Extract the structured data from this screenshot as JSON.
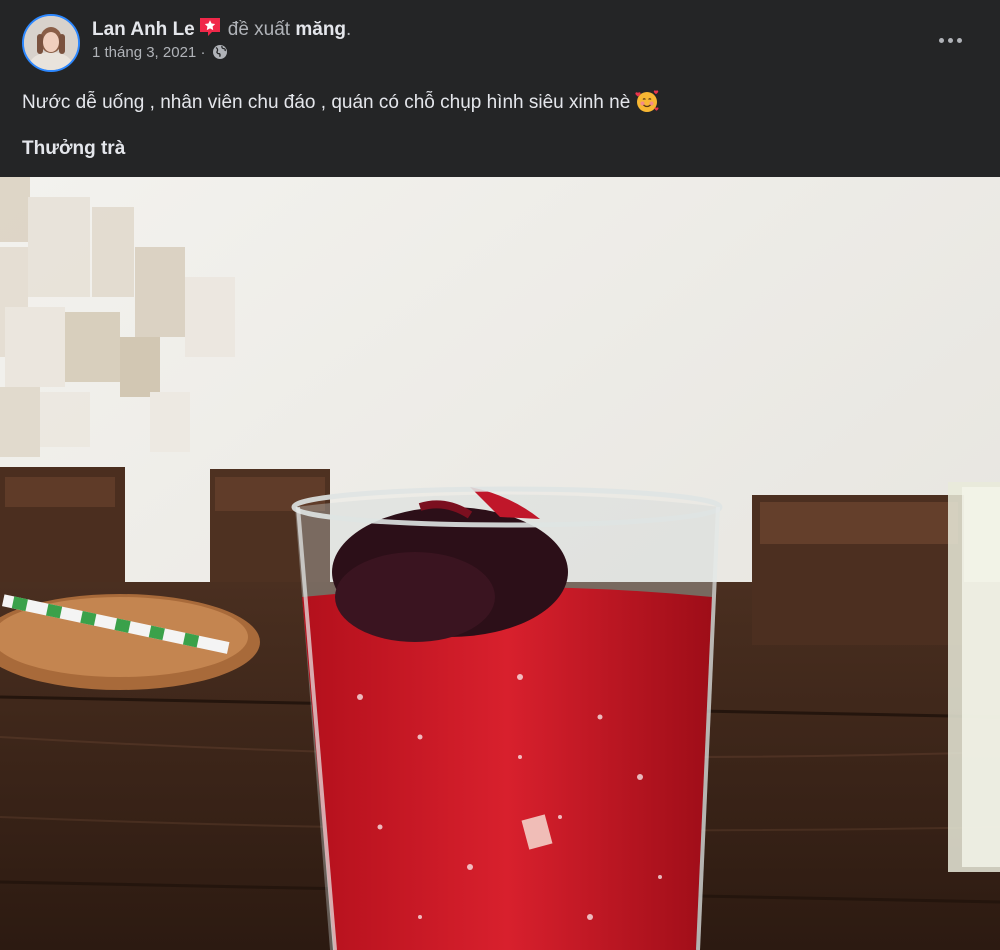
{
  "post": {
    "author": "Lan Anh Le",
    "recommend_text": "đề xuất",
    "page_name": "măng",
    "page_suffix": ".",
    "date": "1 tháng 3, 2021",
    "date_separator": "·",
    "audience_icon": "globe-icon",
    "badge_icon": "star-badge-icon",
    "more_icon": "more-options-icon",
    "body_text": "Nước dễ uống , nhân viên chu đáo , quán có chỗ chụp hình siêu xinh nè",
    "body_emoji": "smiling-face-with-hearts-icon",
    "category": "Thưởng trà"
  },
  "colors": {
    "background": "#242526",
    "text_primary": "#e4e6eb",
    "text_secondary": "#b0b3b8",
    "avatar_ring": "#2d88ff",
    "badge": "#f02849"
  }
}
